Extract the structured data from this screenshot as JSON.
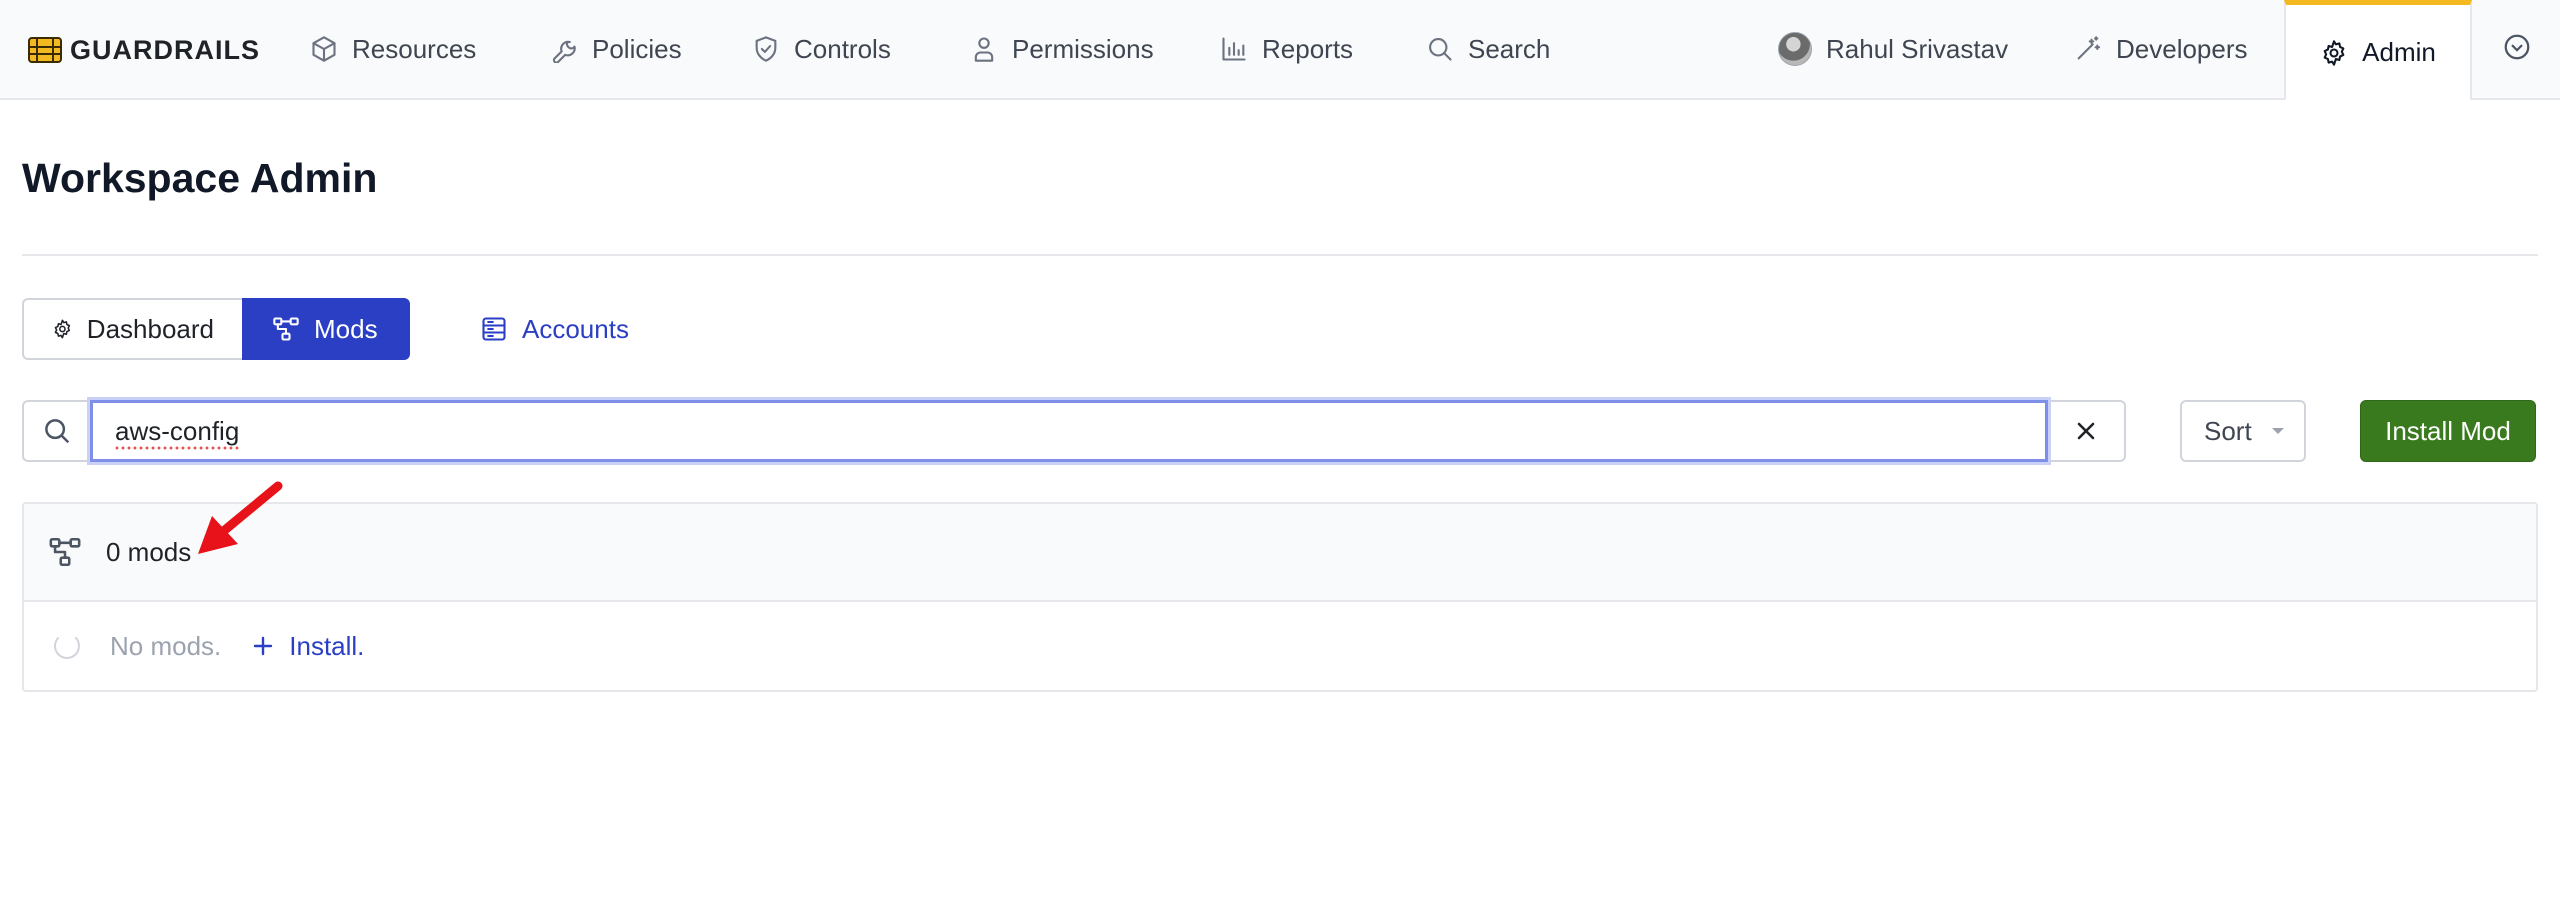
{
  "brand": {
    "name": "GUARDRAILS",
    "logo_icon": "guardrails-logo-icon"
  },
  "nav": {
    "items": [
      {
        "label": "Resources",
        "icon": "cube-icon"
      },
      {
        "label": "Policies",
        "icon": "wrench-icon"
      },
      {
        "label": "Controls",
        "icon": "shield-check-icon"
      },
      {
        "label": "Permissions",
        "icon": "user-badge-icon"
      },
      {
        "label": "Reports",
        "icon": "bar-chart-icon"
      },
      {
        "label": "Search",
        "icon": "search-icon"
      }
    ],
    "user": {
      "name": "Rahul Srivastav"
    },
    "developers": {
      "label": "Developers",
      "icon": "magic-wand-icon"
    },
    "admin": {
      "label": "Admin",
      "icon": "gear-icon",
      "active": true
    },
    "accent_color": "#f3b91e"
  },
  "page": {
    "title": "Workspace Admin"
  },
  "tabs": [
    {
      "label": "Dashboard",
      "icon": "gear-icon",
      "active": false
    },
    {
      "label": "Mods",
      "icon": "mods-tree-icon",
      "active": true
    },
    {
      "label": "Accounts",
      "icon": "accounts-icon",
      "active": false
    }
  ],
  "search": {
    "value": "aws-config",
    "clear_icon": "close-icon"
  },
  "sort": {
    "label": "Sort"
  },
  "install_button": {
    "label": "Install Mod",
    "color": "#3a7a1e"
  },
  "results": {
    "count_label": "0 mods",
    "empty_text": "No mods.",
    "install_link": "Install."
  },
  "colors": {
    "primary": "#2a3fc4",
    "annotation_arrow": "#e8121b"
  }
}
